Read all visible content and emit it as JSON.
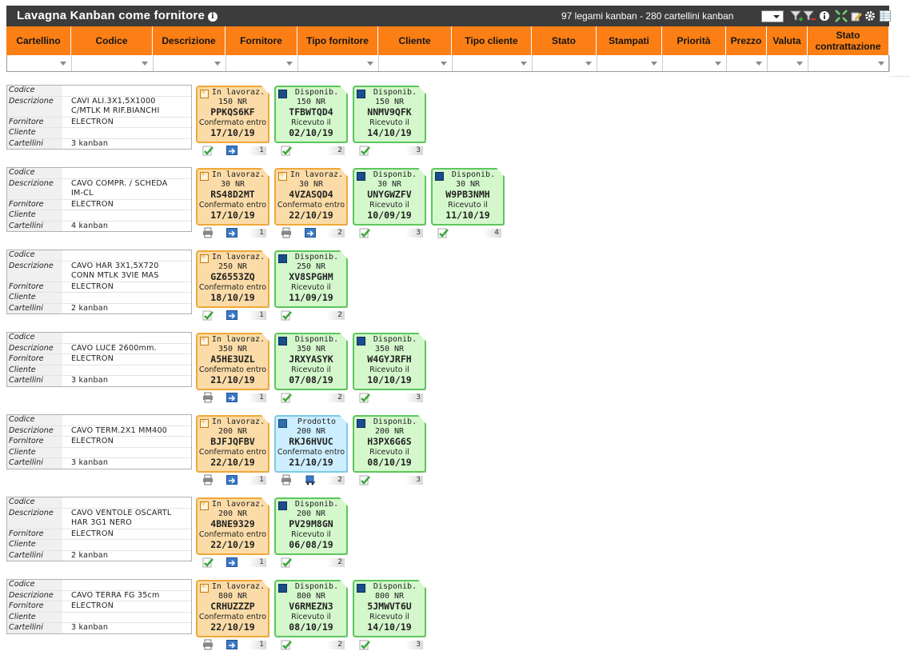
{
  "title": "Lavagna Kanban come fornitore",
  "summary": "97 legami kanban - 280 cartellini kanban",
  "columns": [
    "Cartellino",
    "Codice",
    "Descrizione",
    "Fornitore",
    "Tipo fornitore",
    "Cliente",
    "Tipo cliente",
    "Stato",
    "Stampati",
    "Priorità",
    "Prezzo",
    "Valuta",
    "Stato contrattazione"
  ],
  "info_labels": {
    "codice": "Codice",
    "descrizione": "Descrizione",
    "fornitore": "Fornitore",
    "cliente": "Cliente",
    "cartellini": "Cartellini"
  },
  "groups": [
    {
      "descr_lines": [
        "CAVI ALI.3X1,5X1000",
        "C/MTLK M RIF.BIANCHI"
      ],
      "fornitore": "ELECTRON",
      "cartellini": "3 kanban",
      "cards": [
        {
          "type": "orange",
          "status": "In lavoraz.",
          "qty": "150 NR",
          "code": "PPKQS6KF",
          "sub": "Confermato entro",
          "date": "17/10/19",
          "actions": [
            "check",
            "move"
          ],
          "num": "1"
        },
        {
          "type": "green",
          "status": "Disponib.",
          "qty": "150 NR",
          "code": "TFBWTQD4",
          "sub": "Ricevuto il",
          "date": "02/10/19",
          "actions": [
            "check"
          ],
          "num": "2"
        },
        {
          "type": "green",
          "status": "Disponib.",
          "qty": "150 NR",
          "code": "NNMV9QFK",
          "sub": "Ricevuto il",
          "date": "14/10/19",
          "actions": [
            "check"
          ],
          "num": "3"
        }
      ]
    },
    {
      "descr_lines": [
        "CAVO COMPR. / SCHEDA",
        "IM-CL"
      ],
      "fornitore": "ELECTRON",
      "cartellini": "4 kanban",
      "cards": [
        {
          "type": "orange",
          "status": "In lavoraz.",
          "qty": "30 NR",
          "code": "RS48D2MT",
          "sub": "Confermato entro",
          "date": "17/10/19",
          "actions": [
            "print",
            "move"
          ],
          "num": "1"
        },
        {
          "type": "orange",
          "status": "In lavoraz.",
          "qty": "30 NR",
          "code": "4VZASQD4",
          "sub": "Confermato entro",
          "date": "22/10/19",
          "actions": [
            "print",
            "move"
          ],
          "num": "2"
        },
        {
          "type": "green",
          "status": "Disponib.",
          "qty": "30 NR",
          "code": "UNYGWZFV",
          "sub": "Ricevuto il",
          "date": "10/09/19",
          "actions": [
            "check"
          ],
          "num": "3"
        },
        {
          "type": "green",
          "status": "Disponib.",
          "qty": "30 NR",
          "code": "W9PB3NMH",
          "sub": "Ricevuto il",
          "date": "11/10/19",
          "actions": [
            "check"
          ],
          "num": "4"
        }
      ]
    },
    {
      "descr_lines": [
        "CAVO HAR 3X1,5X720",
        "CONN MTLK 3VIE MAS"
      ],
      "fornitore": "ELECTRON",
      "cartellini": "2 kanban",
      "cards": [
        {
          "type": "orange",
          "status": "In lavoraz.",
          "qty": "250 NR",
          "code": "GZ6553ZQ",
          "sub": "Confermato entro",
          "date": "18/10/19",
          "actions": [
            "check",
            "move"
          ],
          "num": "1"
        },
        {
          "type": "green",
          "status": "Disponib.",
          "qty": "250 NR",
          "code": "XV8SPGHM",
          "sub": "Ricevuto il",
          "date": "11/09/19",
          "actions": [
            "check"
          ],
          "num": "2"
        }
      ]
    },
    {
      "descr_lines": [
        "CAVO LUCE 2600mm."
      ],
      "fornitore": "ELECTRON",
      "cartellini": "3 kanban",
      "cards": [
        {
          "type": "orange",
          "status": "In lavoraz.",
          "qty": "350 NR",
          "code": "A5HE3UZL",
          "sub": "Confermato entro",
          "date": "21/10/19",
          "actions": [
            "print",
            "move"
          ],
          "num": "1"
        },
        {
          "type": "green",
          "status": "Disponib.",
          "qty": "350 NR",
          "code": "JRXYASYK",
          "sub": "Ricevuto il",
          "date": "07/08/19",
          "actions": [
            "check"
          ],
          "num": "2"
        },
        {
          "type": "green",
          "status": "Disponib.",
          "qty": "350 NR",
          "code": "W4GYJRFH",
          "sub": "Ricevuto il",
          "date": "10/10/19",
          "actions": [
            "check"
          ],
          "num": "3"
        }
      ]
    },
    {
      "descr_lines": [
        "CAVO TERM.2X1 MM400"
      ],
      "fornitore": "ELECTRON",
      "cartellini": "3 kanban",
      "cards": [
        {
          "type": "orange",
          "status": "In lavoraz.",
          "qty": "200 NR",
          "code": "BJFJQFBV",
          "sub": "Confermato entro",
          "date": "22/10/19",
          "actions": [
            "print",
            "move"
          ],
          "num": "1"
        },
        {
          "type": "blue",
          "status": "Prodotto",
          "qty": "200 NR",
          "code": "RKJ6HVUC",
          "sub": "Confermato entro",
          "date": "21/10/19",
          "actions": [
            "print",
            "cart"
          ],
          "num": "2"
        },
        {
          "type": "green",
          "status": "Disponib.",
          "qty": "200 NR",
          "code": "H3PX6G6S",
          "sub": "Ricevuto il",
          "date": "08/10/19",
          "actions": [
            "check"
          ],
          "num": "3"
        }
      ]
    },
    {
      "descr_lines": [
        "CAVO VENTOLE OSCARTL",
        "HAR 3G1 NERO"
      ],
      "fornitore": "ELECTRON",
      "cartellini": "2 kanban",
      "cards": [
        {
          "type": "orange",
          "status": "In lavoraz.",
          "qty": "200 NR",
          "code": "4BNE9329",
          "sub": "Confermato entro",
          "date": "22/10/19",
          "actions": [
            "check",
            "move"
          ],
          "num": "1"
        },
        {
          "type": "green",
          "status": "Disponib.",
          "qty": "200 NR",
          "code": "PV29M8GN",
          "sub": "Ricevuto il",
          "date": "06/08/19",
          "actions": [
            "check"
          ],
          "num": "2"
        }
      ]
    },
    {
      "descr_lines": [
        "CAVO TERRA FG 35cm"
      ],
      "fornitore": "ELECTRON",
      "cartellini": "3 kanban",
      "cards": [
        {
          "type": "orange",
          "status": "In lavoraz.",
          "qty": "800 NR",
          "code": "CRHUZZZP",
          "sub": "Confermato entro",
          "date": "22/10/19",
          "actions": [
            "print",
            "move"
          ],
          "num": "1"
        },
        {
          "type": "green",
          "status": "Disponib.",
          "qty": "800 NR",
          "code": "V6RMEZN3",
          "sub": "Ricevuto il",
          "date": "08/10/19",
          "actions": [
            "check"
          ],
          "num": "2"
        },
        {
          "type": "green",
          "status": "Disponib.",
          "qty": "800 NR",
          "code": "5JMWVT6U",
          "sub": "Ricevuto il",
          "date": "14/10/19",
          "actions": [
            "check"
          ],
          "num": "3"
        }
      ]
    }
  ],
  "icons": [
    "info-icon",
    "filter-add-icon",
    "filter-remove-icon",
    "info-circle-icon",
    "expand-icon",
    "edit-icon",
    "settings-icon",
    "grid-icon"
  ],
  "colors": {
    "header": "#fb7f14",
    "titlebar": "#3c3c3c",
    "card_orange": "#fbdca8",
    "card_green": "#d4f7cc",
    "card_blue": "#cdeeff"
  }
}
